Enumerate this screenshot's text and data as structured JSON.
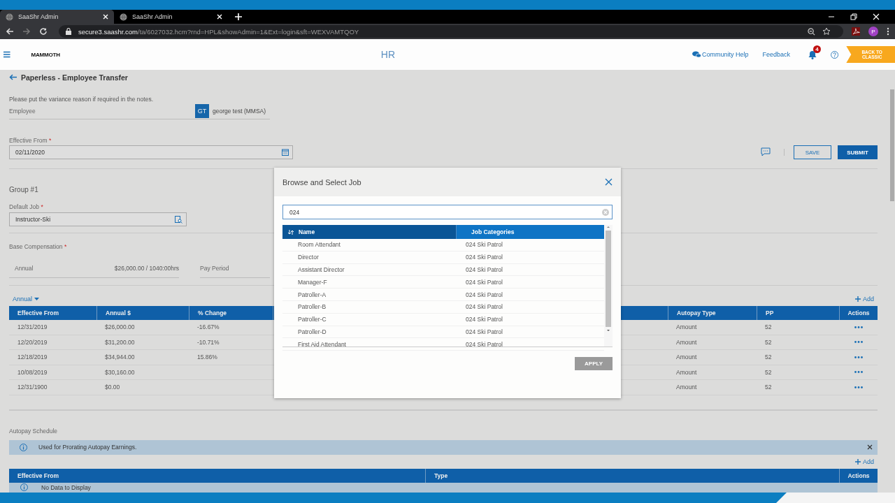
{
  "browser": {
    "tabs": [
      {
        "title": "SaaShr Admin",
        "selected": true
      },
      {
        "title": "SaaShr Admin",
        "selected": false
      }
    ],
    "url_host": "secure3.saashr.com",
    "url_path": "/ta/6027032.hcm?rnd=HPL&showAdmin=1&Ext=login&sft=WEXVAMTQOY",
    "profile_initial": "P"
  },
  "header": {
    "logo": "MAMMOTH",
    "module": "HR",
    "community_help": "Community Help",
    "feedback": "Feedback",
    "notification_count": "4",
    "back_button": "BACK TO CLASSIC"
  },
  "page": {
    "title": "Paperless - Employee Transfer",
    "note": "Please put the variance reason if required in the notes.",
    "employee_label": "Employee",
    "employee_initials": "GT",
    "employee_name": "george test (MMSA)",
    "effective_from": {
      "label": "Effective From",
      "mark": "*",
      "value": "02/11/2020"
    },
    "save": "SAVE",
    "submit": "SUBMIT"
  },
  "group": {
    "title": "Group #1",
    "default_job": {
      "label": "Default Job",
      "mark": "*",
      "value": "Instructor-Ski"
    },
    "base_compensation": {
      "label": "Base Compensation",
      "mark": "*"
    },
    "annual_label": "Annual",
    "annual_value": "$26,000.00 / 1040:00hrs",
    "pay_period_label": "Pay Period",
    "frequency": "Annual",
    "add": "Add"
  },
  "compensation_table": {
    "columns": [
      "Effective From",
      "Annual $",
      "% Change",
      "Autopay Type",
      "PP",
      "Actions"
    ],
    "rows": [
      {
        "effective_from": "12/31/2019",
        "annual": "$26,000.00",
        "change": "-16.67%",
        "autopay_type": "Amount",
        "pp": "52"
      },
      {
        "effective_from": "12/20/2019",
        "annual": "$31,200.00",
        "change": "-10.71%",
        "autopay_type": "Amount",
        "pp": "52"
      },
      {
        "effective_from": "12/18/2019",
        "annual": "$34,944.00",
        "change": "15.86%",
        "autopay_type": "Amount",
        "pp": "52"
      },
      {
        "effective_from": "10/08/2019",
        "annual": "$30,160.00",
        "autopay_type": "Amount",
        "pp": "52"
      },
      {
        "effective_from": "12/31/1900",
        "annual": "$0.00",
        "autopay_type": "Amount",
        "pp": "52"
      }
    ]
  },
  "autopay": {
    "title": "Autopay Schedule",
    "info": "Used for Prorating Autopay Earnings.",
    "add": "Add",
    "columns": [
      "Effective From",
      "Type",
      "Actions"
    ],
    "empty": "No Data to Display"
  },
  "dialog": {
    "title": "Browse and Select Job",
    "search": "024",
    "columns": [
      {
        "label": "Name",
        "sorted": true
      },
      {
        "label": "Job Categories",
        "sorted": false
      }
    ],
    "rows": [
      {
        "name": "Room Attendant",
        "category": "024 Ski Patrol"
      },
      {
        "name": "Director",
        "category": "024 Ski Patrol"
      },
      {
        "name": "Assistant Director",
        "category": "024 Ski Patrol"
      },
      {
        "name": "Manager-F",
        "category": "024 Ski Patrol"
      },
      {
        "name": "Patroller-A",
        "category": "024 Ski Patrol"
      },
      {
        "name": "Patroller-B",
        "category": "024 Ski Patrol"
      },
      {
        "name": "Patroller-C",
        "category": "024 Ski Patrol"
      },
      {
        "name": "Patroller-D",
        "category": "024 Ski Patrol"
      },
      {
        "name": "First Aid Attendant",
        "category": "024 Ski Patrol"
      }
    ],
    "apply": "APPLY",
    "apply_disabled": true
  }
}
